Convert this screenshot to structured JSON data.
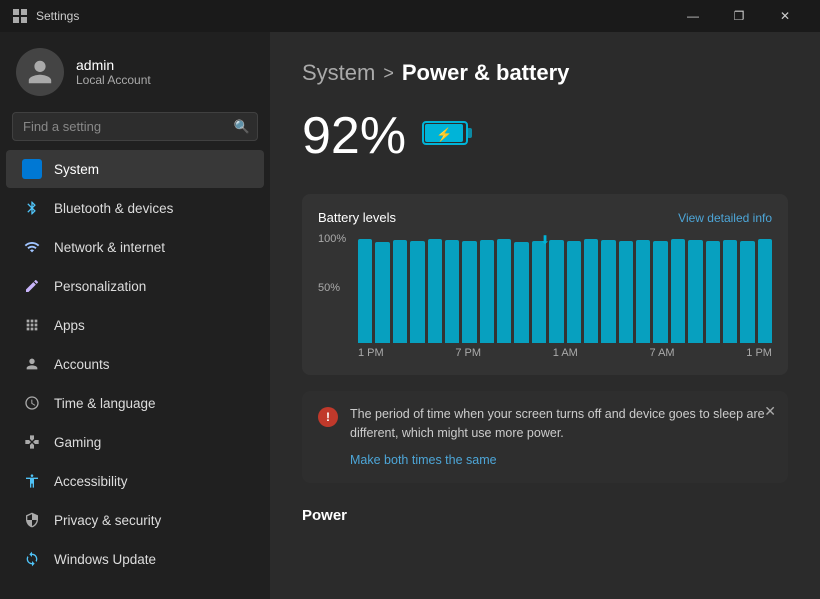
{
  "titlebar": {
    "title": "Settings",
    "min_btn": "—",
    "max_btn": "❐",
    "close_btn": "✕"
  },
  "sidebar": {
    "search_placeholder": "Find a setting",
    "user": {
      "name": "admin",
      "type": "Local Account"
    },
    "items": [
      {
        "id": "system",
        "label": "System",
        "icon": "⊞",
        "active": true
      },
      {
        "id": "bluetooth",
        "label": "Bluetooth & devices",
        "icon": "🔷"
      },
      {
        "id": "network",
        "label": "Network & internet",
        "icon": "🌐"
      },
      {
        "id": "personalization",
        "label": "Personalization",
        "icon": "✏️"
      },
      {
        "id": "apps",
        "label": "Apps",
        "icon": "📦"
      },
      {
        "id": "accounts",
        "label": "Accounts",
        "icon": "👤"
      },
      {
        "id": "time",
        "label": "Time & language",
        "icon": "🕐"
      },
      {
        "id": "gaming",
        "label": "Gaming",
        "icon": "🎮"
      },
      {
        "id": "accessibility",
        "label": "Accessibility",
        "icon": "♿"
      },
      {
        "id": "privacy",
        "label": "Privacy & security",
        "icon": "🔒"
      },
      {
        "id": "update",
        "label": "Windows Update",
        "icon": "🔄"
      }
    ]
  },
  "content": {
    "breadcrumb_parent": "System",
    "breadcrumb_sep": ">",
    "breadcrumb_current": "Power & battery",
    "battery_percent": "92%",
    "chart": {
      "title": "Battery levels",
      "link": "View detailed info",
      "y_labels": [
        "100%",
        "50%"
      ],
      "x_labels": [
        "1 PM",
        "7 PM",
        "1 AM",
        "7 AM",
        "1 PM"
      ],
      "bars": [
        95,
        92,
        94,
        93,
        95,
        94,
        93,
        94,
        95,
        92,
        93,
        94,
        93,
        95,
        94,
        93,
        94,
        93,
        95,
        94,
        93,
        94,
        93,
        95
      ]
    },
    "alert": {
      "text": "The period of time when your screen turns off and device goes to sleep are different, which might use more power.",
      "link": "Make both times the same"
    },
    "power_section": "Power"
  }
}
